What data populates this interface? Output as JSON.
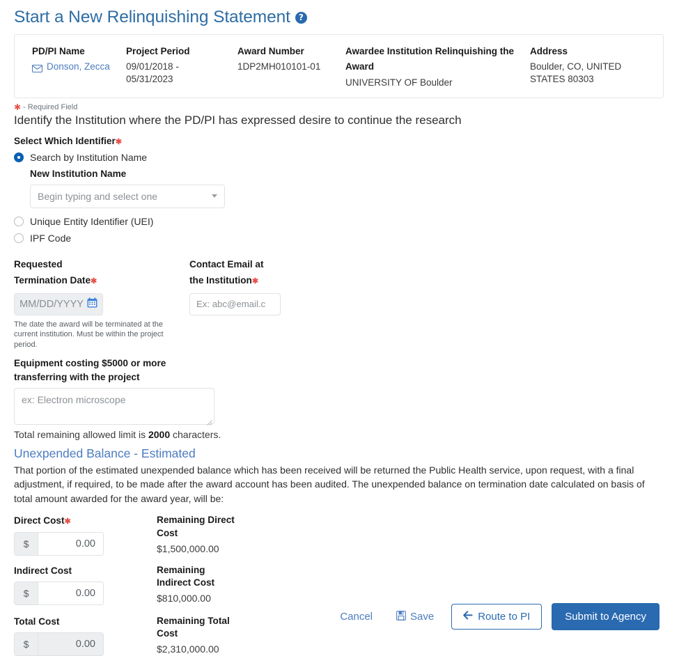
{
  "page": {
    "title": "Start a New Relinquishing Statement",
    "help_icon": "help-circle-icon"
  },
  "award_summary": {
    "columns": [
      {
        "header": "PD/PI Name",
        "value": "Donson, Zecca",
        "icon": "envelope-icon"
      },
      {
        "header": "Project Period",
        "value": "09/01/2018 - 05/31/2023"
      },
      {
        "header": "Award Number",
        "value": "1DP2MH010101-01"
      },
      {
        "header": "Awardee Institution Relinquishing the Award",
        "value": "UNIVERSITY OF Boulder"
      },
      {
        "header": "Address",
        "value": "Boulder, CO, UNITED STATES 80303"
      }
    ]
  },
  "required_note": "- Required Field",
  "identify_instruction": "Identify the Institution where the PD/PI has expressed desire to continue the research",
  "identifier": {
    "label": "Select Which Identifier",
    "options": [
      {
        "label": "Search by Institution Name",
        "selected": true
      },
      {
        "label": "Unique Entity Identifier (UEI)",
        "selected": false
      },
      {
        "label": "IPF Code",
        "selected": false
      }
    ],
    "institution_name_label": "New Institution Name",
    "institution_placeholder": "Begin typing and select one"
  },
  "termination": {
    "label_line1": "Requested",
    "label_line2": "Termination  Date",
    "date_placeholder": "MM/DD/YYYY",
    "calendar_icon": "calendar-icon",
    "helper": "The date the award  will be terminated at the current institution. Must be within the project period."
  },
  "contact_email": {
    "label_line1": "Contact Email at",
    "label_line2": "the Institution",
    "placeholder": "Ex: abc@email.c",
    "value": ""
  },
  "equipment": {
    "label_line1": "Equipment costing $5000 or more",
    "label_line2": "transferring with the project",
    "placeholder": "ex: Electron microscope",
    "value": "",
    "limit_prefix": "Total remaining allowed limit is",
    "limit_value": "2000",
    "limit_suffix": "characters."
  },
  "unexpended": {
    "title": "Unexpended Balance - Estimated",
    "paragraph": "That portion of the estimated unexpended balance which has been received will be returned the Public Health service, upon request, with a final adjustment, if required, to be made after the award account has been audited. The unexpended balance on termination date calculated on basis of total amount awarded for the award year, will be:",
    "rows": [
      {
        "label": "Direct Cost",
        "required": true,
        "currency": "$",
        "value": "0.00",
        "disabled": false,
        "remaining_label_line1": "Remaining Direct",
        "remaining_label_line2": "Cost",
        "remaining_value": "$1,500,000.00"
      },
      {
        "label": "Indirect Cost",
        "required": false,
        "currency": "$",
        "value": "0.00",
        "disabled": false,
        "remaining_label_line1": "Remaining",
        "remaining_label_line2": "Indirect Cost",
        "remaining_value": "$810,000.00"
      },
      {
        "label": "Total Cost",
        "required": false,
        "currency": "$",
        "value": "0.00",
        "disabled": true,
        "remaining_label_line1": "Remaining Total",
        "remaining_label_line2": "Cost",
        "remaining_value": "$2,310,000.00"
      }
    ]
  },
  "actions": {
    "cancel": "Cancel",
    "save": "Save",
    "save_icon": "floppy-disk-icon",
    "route": "Route to PI",
    "route_icon": "arrow-left-icon",
    "submit": "Submit to Agency"
  },
  "colors": {
    "brand_blue": "#2a6ab0",
    "link_blue": "#4c7cc0",
    "required_red": "#e8524a",
    "field_gray": "#eceef0"
  }
}
